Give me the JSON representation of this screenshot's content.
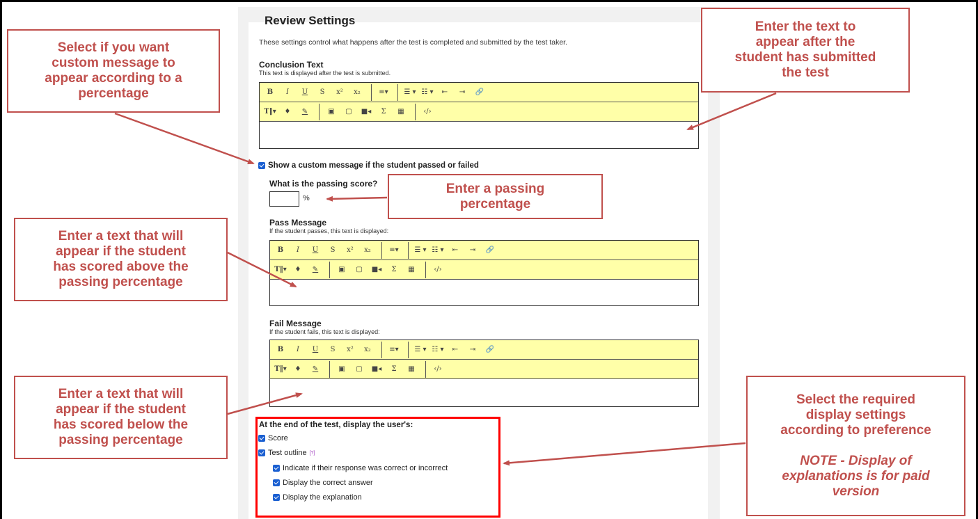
{
  "review": {
    "title": "Review Settings",
    "description": "These settings control what happens after the test is completed and submitted by the test taker."
  },
  "conclusion": {
    "title": "Conclusion Text",
    "help": "This text is displayed after the test is submitted."
  },
  "custom_message": {
    "checkbox_label": "Show a custom message if the student passed or failed",
    "passing_score_label": "What is the passing score?",
    "passing_score_value": "",
    "percent": "%"
  },
  "pass_message": {
    "title": "Pass Message",
    "help": "If the student passes, this text is displayed:"
  },
  "fail_message": {
    "title": "Fail Message",
    "help": "If the student fails, this text is displayed:"
  },
  "end_display": {
    "title": "At the end of the test, display the user's:",
    "score": "Score",
    "outline": "Test outline",
    "outline_help": "[?]",
    "indicate": "Indicate if their response was correct or incorrect",
    "correct_answer": "Display the correct answer",
    "explanation": "Display the explanation"
  },
  "toolbar": {
    "row1": [
      "B",
      "I",
      "U",
      "S",
      "x²",
      "x₂",
      "≡▾",
      "☰ ▾",
      "☷ ▾",
      "⇤",
      "⇥",
      "🔗"
    ],
    "row2": [
      "T‖▾",
      "♦",
      "✎",
      "▣",
      "▢",
      "■◂",
      "Σ",
      "▦",
      "‹/›"
    ]
  },
  "callouts": {
    "custom_message": [
      "Select if you want",
      "custom message to",
      "appear according to a",
      "percentage"
    ],
    "conclusion": [
      "Enter the text to",
      "appear after the",
      "student has submitted",
      "the test"
    ],
    "passing": [
      "Enter a passing",
      "percentage"
    ],
    "pass_text": [
      "Enter a text that will",
      "appear if the student",
      "has scored above the",
      "passing percentage"
    ],
    "fail_text": [
      "Enter a text that will",
      "appear if the student",
      "has scored below the",
      "passing percentage"
    ],
    "display": [
      "Select the required",
      "display settings",
      "according to preference"
    ],
    "display_note": [
      "NOTE - Display of",
      "explanations is for paid",
      "version"
    ]
  },
  "colors": {
    "callout": "#c0504d",
    "toolbar": "#ffffa8",
    "highlight_box": "#ff0000",
    "checkbox": "#1a5fd1"
  }
}
